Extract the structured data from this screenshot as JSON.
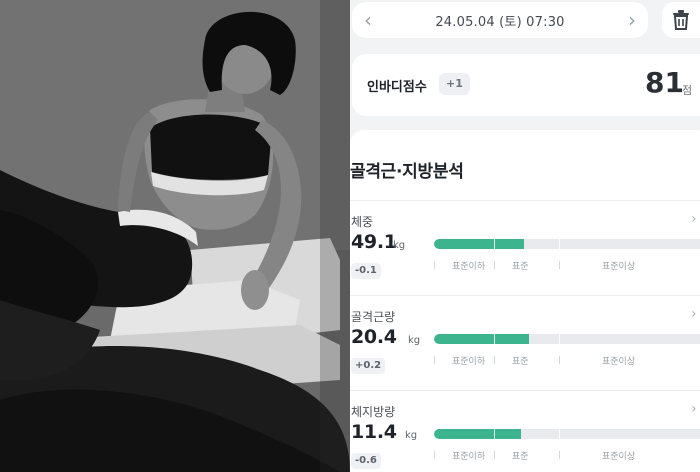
{
  "header": {
    "date_text": "24.05.04 (토) 07:30",
    "prev_icon": "chevron-left-icon",
    "next_icon": "chevron-right-icon",
    "delete_icon": "trash-icon"
  },
  "score": {
    "label": "인바디점수",
    "delta": "+1",
    "value": "81",
    "unit": "점"
  },
  "section": {
    "title": "골격근·지방분석"
  },
  "metrics": [
    {
      "name": "체중",
      "value": "49.1",
      "unit": "kg",
      "delta": "-0.1",
      "level": 0.33
    },
    {
      "name": "골격근량",
      "value": "20.4",
      "unit": "kg",
      "delta": "+0.2",
      "level": 0.35
    },
    {
      "name": "체지방량",
      "value": "11.4",
      "unit": "kg",
      "delta": "-0.6",
      "level": 0.32
    }
  ],
  "scale_labels": [
    "표준이하",
    "표준",
    "표준이상"
  ],
  "colors": {
    "bar_fill": "#3cb48e",
    "bar_track": "#e9eaee",
    "background": "#f2f3f5"
  }
}
